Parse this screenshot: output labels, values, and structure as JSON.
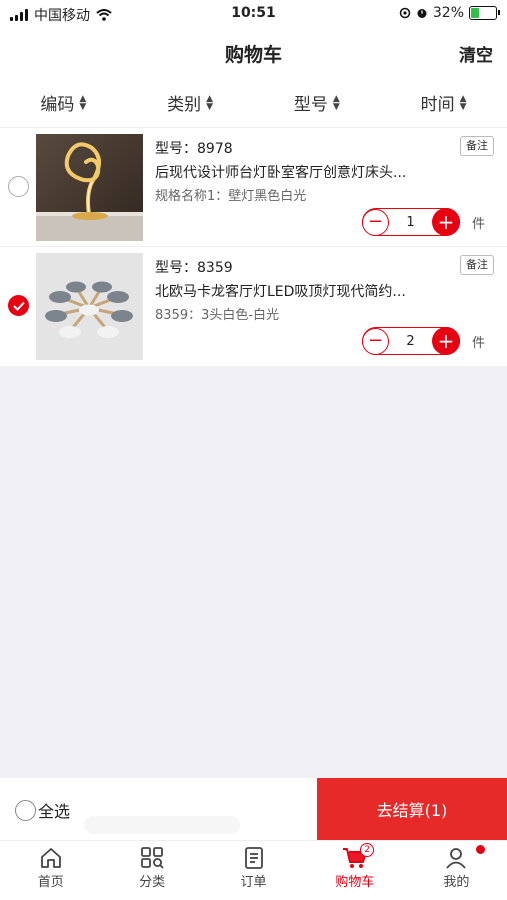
{
  "status": {
    "carrier": "中国移动",
    "time": "10:51",
    "battery": "32%",
    "battery_level": 0.32
  },
  "nav": {
    "title": "购物车",
    "clear_label": "清空"
  },
  "sort": [
    {
      "label": "编码"
    },
    {
      "label": "类别"
    },
    {
      "label": "型号"
    },
    {
      "label": "时间"
    }
  ],
  "items": [
    {
      "model": "型号：8978",
      "name": "后现代设计师台灯卧室客厅创意灯床头...",
      "spec": "规格名称1：壁灯黑色白光",
      "note": "备注",
      "qty": "1",
      "unit": "件",
      "checked": false
    },
    {
      "model": "型号：8359",
      "name": "北欧马卡龙客厅灯LED吸顶灯现代简约...",
      "spec": "8359：3头白色-白光",
      "note": "备注",
      "qty": "2",
      "unit": "件",
      "checked": true
    }
  ],
  "bottom": {
    "select_all": "全选",
    "checkout": "去结算(1)"
  },
  "tabs": [
    {
      "label": "首页",
      "icon": "home-icon"
    },
    {
      "label": "分类",
      "icon": "category-icon"
    },
    {
      "label": "订单",
      "icon": "order-icon"
    },
    {
      "label": "购物车",
      "icon": "cart-icon",
      "badge": "2",
      "active": true
    },
    {
      "label": "我的",
      "icon": "user-icon"
    }
  ],
  "colors": {
    "accent": "#e60012",
    "checkout_bg": "#e62a2a",
    "page_bg": "#efeff4"
  }
}
